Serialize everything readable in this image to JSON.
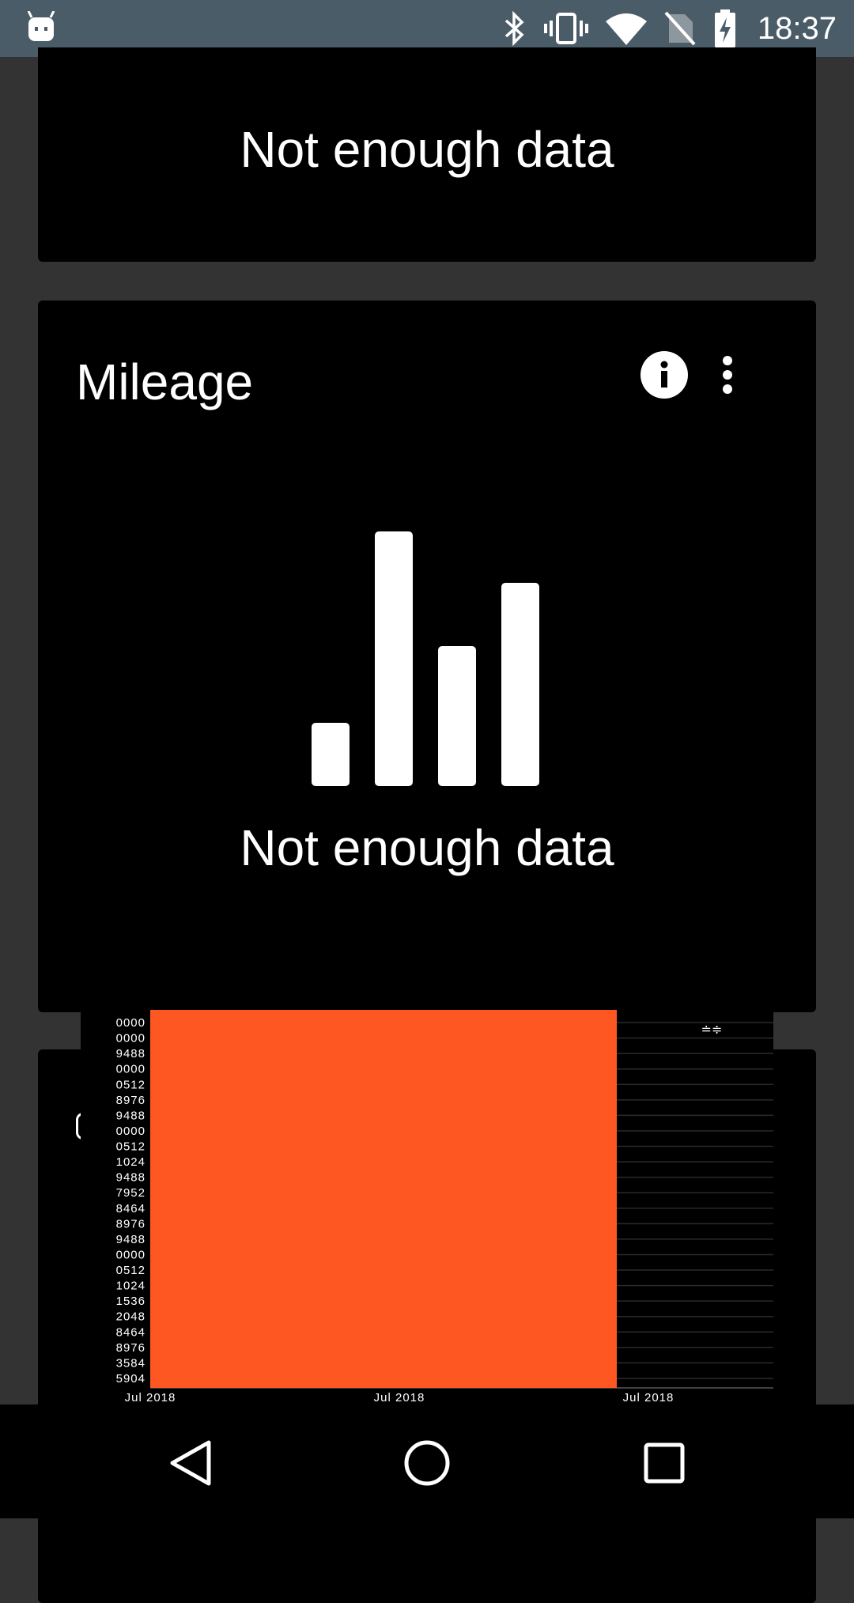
{
  "status_bar": {
    "time": "18:37",
    "icons": [
      "android-icon",
      "bluetooth-icon",
      "vibrate-icon",
      "wifi-icon",
      "no-sim-icon",
      "battery-charging-icon"
    ]
  },
  "cards": {
    "top": {
      "message": "Not enough data"
    },
    "mileage": {
      "title": "Mileage",
      "message": "Not enough data",
      "icons": [
        "info-icon",
        "more-vert-icon",
        "bar-chart-icon"
      ]
    }
  },
  "chart_data": {
    "type": "bar",
    "title": "",
    "xlabel": "",
    "ylabel": "",
    "categories": [
      "Jul 2018",
      "Jul 2018",
      "Jul 2018"
    ],
    "y_tick_labels": [
      "0000",
      "0000",
      "9488",
      "0000",
      "0512",
      "8976",
      "9488",
      "0000",
      "0512",
      "1024",
      "9488",
      "7952",
      "8464",
      "8976",
      "9488",
      "0000",
      "0512",
      "1024",
      "1536",
      "2048",
      "8464",
      "8976",
      "3584",
      "5904"
    ],
    "series": [
      {
        "values": [
          1,
          0
        ]
      }
    ],
    "bar_color": "#ff5722",
    "grid": true,
    "corner_glyph": "≐≑"
  },
  "nav_bar": {
    "icons": [
      "back-icon",
      "home-icon",
      "recents-icon"
    ]
  }
}
